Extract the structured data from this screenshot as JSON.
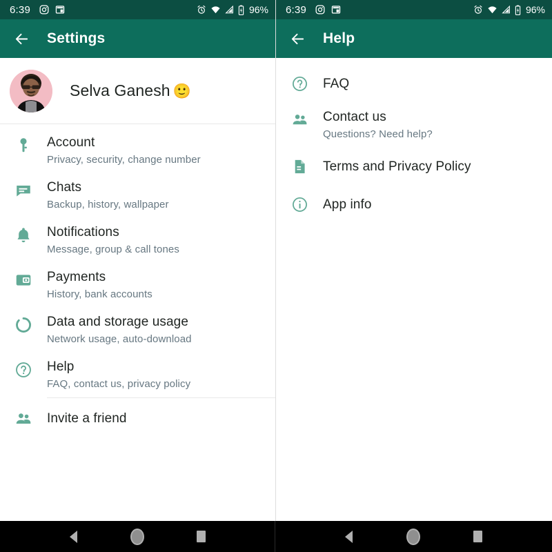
{
  "status_bar": {
    "time": "6:39",
    "battery_percent": "96%",
    "left_icons": [
      "instagram-icon",
      "calendar-icon"
    ],
    "right_icons": [
      "alarm-icon",
      "wifi-icon",
      "signal-icon",
      "battery-icon"
    ],
    "background_color": "#0c4e42"
  },
  "colors": {
    "appbar": "#0d6e5c",
    "statusbar": "#0c4e42",
    "icon_teal": "#62aa96",
    "title_text": "#1f2421",
    "subtitle_text": "#667781",
    "navbar": "#000000"
  },
  "left_panel": {
    "appbar": {
      "back_icon": "arrow-back-icon",
      "title": "Settings"
    },
    "profile": {
      "name": "Selva Ganesh",
      "emoji": "🙂",
      "avatar_alt": "avatar"
    },
    "items": [
      {
        "icon": "key-icon",
        "title": "Account",
        "subtitle": "Privacy, security, change number"
      },
      {
        "icon": "chat-icon",
        "title": "Chats",
        "subtitle": "Backup, history, wallpaper"
      },
      {
        "icon": "bell-icon",
        "title": "Notifications",
        "subtitle": "Message, group & call tones"
      },
      {
        "icon": "wallet-icon",
        "title": "Payments",
        "subtitle": "History, bank accounts"
      },
      {
        "icon": "data-usage-icon",
        "title": "Data and storage usage",
        "subtitle": "Network usage, auto-download"
      },
      {
        "icon": "help-circle-icon",
        "title": "Help",
        "subtitle": "FAQ, contact us, privacy policy"
      }
    ],
    "invite": {
      "icon": "people-icon",
      "title": "Invite a friend"
    }
  },
  "right_panel": {
    "appbar": {
      "back_icon": "arrow-back-icon",
      "title": "Help"
    },
    "items": [
      {
        "icon": "help-circle-icon",
        "title": "FAQ",
        "subtitle": ""
      },
      {
        "icon": "people-icon",
        "title": "Contact us",
        "subtitle": "Questions? Need help?"
      },
      {
        "icon": "document-icon",
        "title": "Terms and Privacy Policy",
        "subtitle": ""
      },
      {
        "icon": "info-circle-icon",
        "title": "App info",
        "subtitle": ""
      }
    ]
  },
  "nav_bar": {
    "buttons": [
      "back-nav-button",
      "home-nav-button",
      "recents-nav-button"
    ]
  }
}
